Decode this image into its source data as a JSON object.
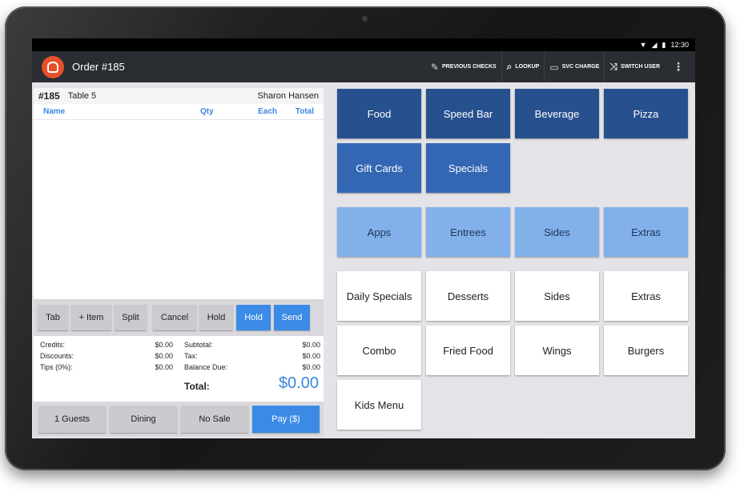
{
  "status": {
    "time": "12:30",
    "wifi_icon": "wifi-icon",
    "signal_icon": "signal-icon",
    "battery_icon": "battery-icon"
  },
  "app": {
    "title": "Order #185",
    "logo_icon": "restaurant-logo-icon"
  },
  "toolbar": {
    "items": [
      {
        "label": "PREVIOUS CHECKS",
        "icon": "pen-icon",
        "glyph": "✎"
      },
      {
        "label": "LOOKUP",
        "icon": "search-icon",
        "glyph": "⌕"
      },
      {
        "label": "SVC CHARGE",
        "icon": "card-icon",
        "glyph": "▭"
      },
      {
        "label": "SWITCH USER",
        "icon": "shuffle-icon",
        "glyph": "⤨"
      }
    ],
    "overflow_glyph": "⋮"
  },
  "order": {
    "number": "#185",
    "table": "Table 5",
    "server": "Sharon Hansen",
    "columns": {
      "name": "Name",
      "qty": "Qty",
      "each": "Each",
      "total": "Total"
    }
  },
  "actions": {
    "tab": "Tab",
    "add_item": "+ Item",
    "split": "Split",
    "cancel": "Cancel",
    "hold_gray": "Hold",
    "hold_blue": "Hold",
    "send": "Send"
  },
  "totals": {
    "credits_label": "Credits:",
    "credits": "$0.00",
    "discounts_label": "Discounts:",
    "discounts": "$0.00",
    "tips_label": "Tips (0%):",
    "tips": "$0.00",
    "subtotal_label": "Subtotal:",
    "subtotal": "$0.00",
    "tax_label": "Tax:",
    "tax": "$0.00",
    "balance_label": "Balance Due:",
    "balance": "$0.00",
    "total_label": "Total:",
    "total": "$0.00"
  },
  "bottom": {
    "guests": "1 Guests",
    "dining": "Dining",
    "no_sale": "No Sale",
    "pay": "Pay ($)"
  },
  "menu": {
    "row1": [
      "Food",
      "Speed Bar",
      "Beverage",
      "Pizza"
    ],
    "row2": [
      "Gift Cards",
      "Specials"
    ],
    "row3": [
      "Apps",
      "Entrees",
      "Sides",
      "Extras"
    ],
    "row4": [
      "Daily Specials",
      "Desserts",
      "Sides",
      "Extras"
    ],
    "row5": [
      "Combo",
      "Fried Food",
      "Wings",
      "Burgers"
    ],
    "row6": [
      "Kids Menu"
    ]
  },
  "colors": {
    "accent": "#3b8be6",
    "logo": "#e8502a",
    "tile_dark": "#27508f",
    "tile_mid": "#3366b3",
    "tile_light": "#82b1ea"
  }
}
